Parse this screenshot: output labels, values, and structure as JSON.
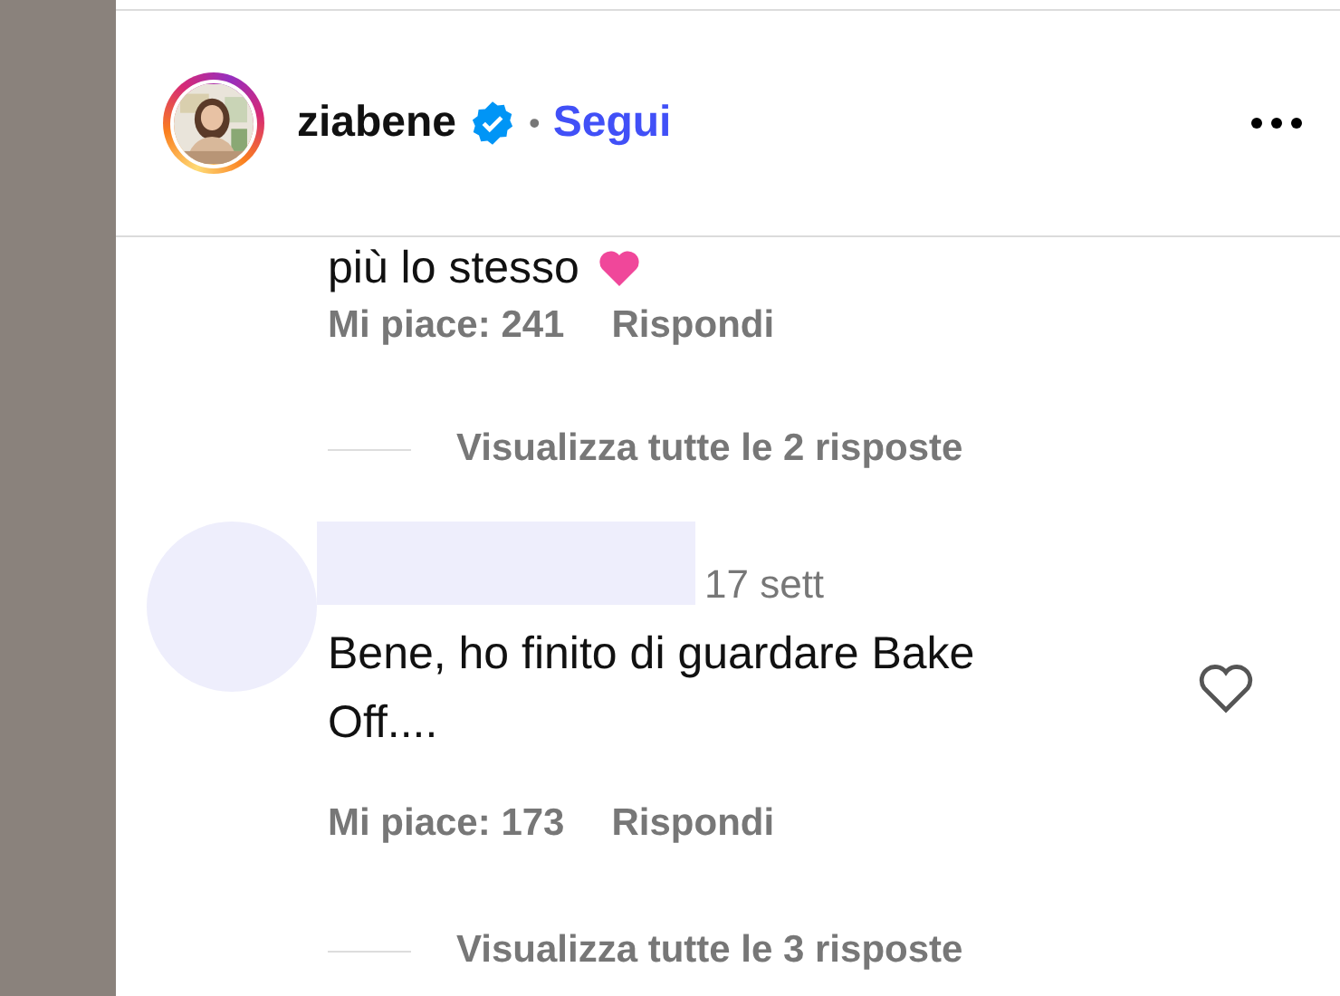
{
  "header": {
    "username": "ziabene",
    "verified": true,
    "separator": "•",
    "follow_label": "Segui"
  },
  "comments": [
    {
      "kind": "cut",
      "text": "più lo stesso",
      "trailing_heart": true,
      "likes": "Mi piace: 241",
      "reply_label": "Rispondi",
      "view_replies": "Visualizza tutte le 2 risposte"
    },
    {
      "kind": "full",
      "name_redacted": true,
      "time": "17 sett",
      "text": "Bene, ho finito di guardare Bake Off....",
      "liked": false,
      "likes": "Mi piace: 173",
      "reply_label": "Rispondi",
      "view_replies": "Visualizza tutte le 3 risposte"
    }
  ]
}
